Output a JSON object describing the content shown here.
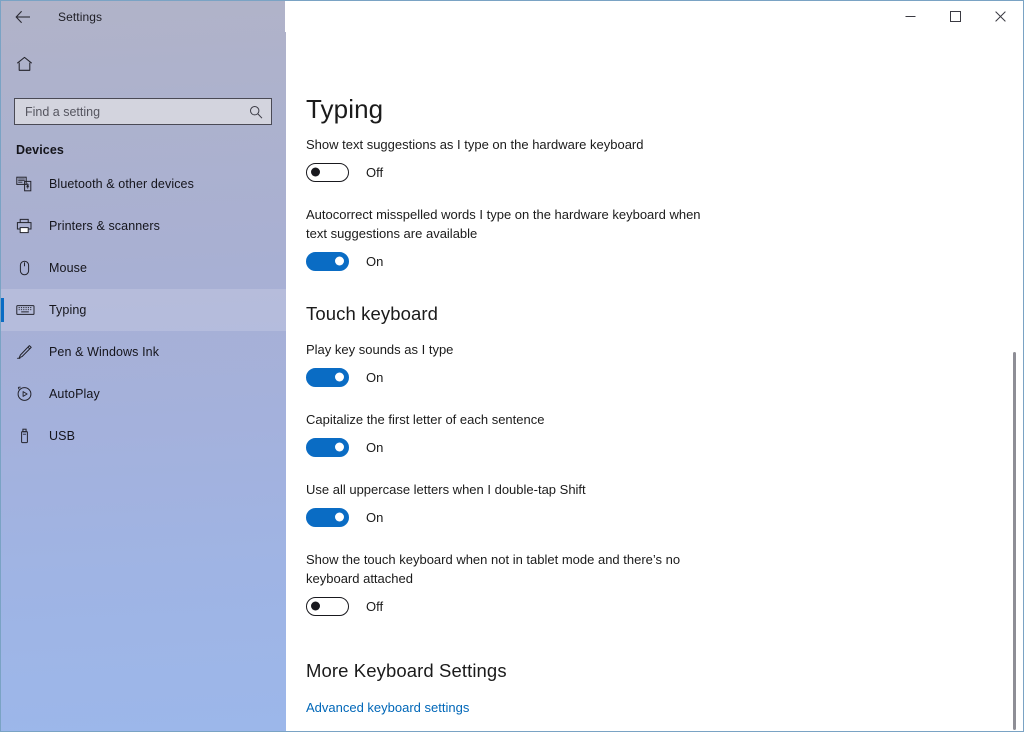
{
  "window": {
    "title": "Settings",
    "back_icon": "back-arrow-icon",
    "controls": {
      "minimize": "minimize-icon",
      "maximize": "maximize-icon",
      "close": "close-icon"
    }
  },
  "sidebar": {
    "home_icon": "home-icon",
    "search": {
      "placeholder": "Find a setting",
      "value": "",
      "icon": "search-icon"
    },
    "category_heading": "Devices",
    "items": [
      {
        "label": "Bluetooth & other devices",
        "icon": "bluetooth-devices-icon",
        "selected": false
      },
      {
        "label": "Printers & scanners",
        "icon": "printer-icon",
        "selected": false
      },
      {
        "label": "Mouse",
        "icon": "mouse-icon",
        "selected": false
      },
      {
        "label": "Typing",
        "icon": "keyboard-icon",
        "selected": true
      },
      {
        "label": "Pen & Windows Ink",
        "icon": "pen-icon",
        "selected": false
      },
      {
        "label": "AutoPlay",
        "icon": "autoplay-icon",
        "selected": false
      },
      {
        "label": "USB",
        "icon": "usb-icon",
        "selected": false
      }
    ]
  },
  "main": {
    "page_title": "Typing",
    "sections": [
      {
        "heading": "",
        "settings": [
          {
            "label": "Show text suggestions as I type on the hardware keyboard",
            "state": "Off",
            "on": false
          },
          {
            "label": "Autocorrect misspelled words I type on the hardware keyboard when text suggestions are available",
            "state": "On",
            "on": true
          }
        ]
      },
      {
        "heading": "Touch keyboard",
        "settings": [
          {
            "label": "Play key sounds as I type",
            "state": "On",
            "on": true
          },
          {
            "label": "Capitalize the first letter of each sentence",
            "state": "On",
            "on": true
          },
          {
            "label": "Use all uppercase letters when I double-tap Shift",
            "state": "On",
            "on": true
          },
          {
            "label": "Show the touch keyboard when not in tablet mode and there’s no keyboard attached",
            "state": "Off",
            "on": false
          }
        ]
      }
    ],
    "more_settings_heading": "More Keyboard Settings",
    "advanced_link": "Advanced keyboard settings"
  },
  "colors": {
    "accent": "#0a6cc4",
    "link": "#0067b8",
    "text": "#1b1b1b"
  }
}
